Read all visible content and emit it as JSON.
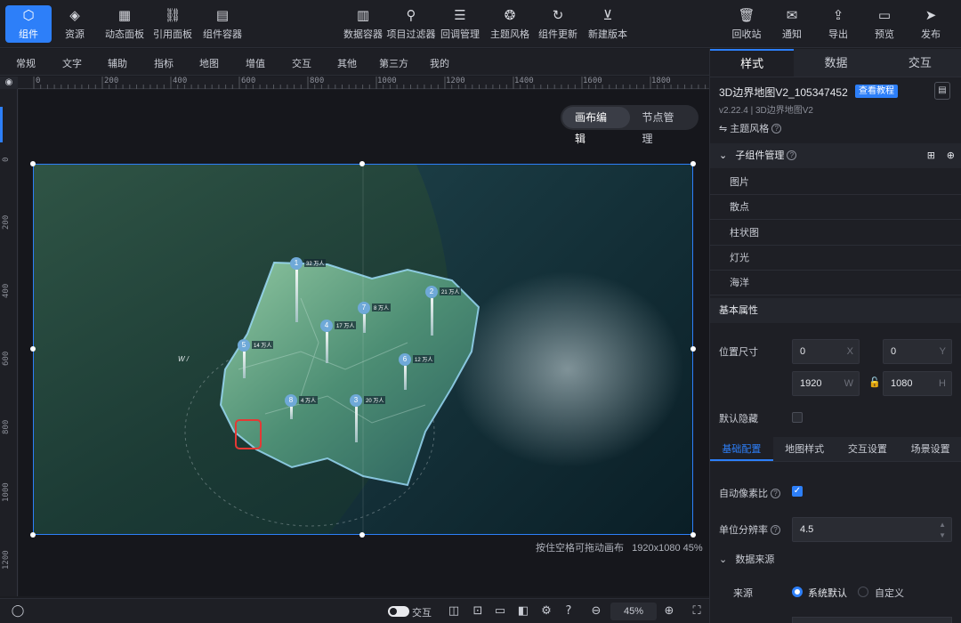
{
  "toolbar": {
    "left": [
      {
        "label": "组件",
        "icon": "component-icon"
      },
      {
        "label": "资源",
        "icon": "layers-icon"
      },
      {
        "label": "动态面板",
        "icon": "panel-icon"
      },
      {
        "label": "引用面板",
        "icon": "link-icon"
      },
      {
        "label": "组件容器",
        "icon": "container-icon"
      }
    ],
    "center": [
      {
        "label": "数据容器",
        "icon": "data-container-icon"
      },
      {
        "label": "项目过滤器",
        "icon": "filter-icon"
      },
      {
        "label": "回调管理",
        "icon": "sliders-icon"
      },
      {
        "label": "主题风格",
        "icon": "palette-icon"
      },
      {
        "label": "组件更新",
        "icon": "refresh-icon"
      },
      {
        "label": "新建版本",
        "icon": "version-icon"
      }
    ],
    "right": [
      {
        "label": "回收站",
        "icon": "trash-icon"
      },
      {
        "label": "通知",
        "icon": "message-icon"
      },
      {
        "label": "导出",
        "icon": "export-icon"
      },
      {
        "label": "预览",
        "icon": "preview-icon"
      },
      {
        "label": "发布",
        "icon": "send-icon"
      }
    ]
  },
  "categories": [
    "常规",
    "文字",
    "辅助",
    "指标",
    "地图",
    "增值",
    "交互",
    "其他",
    "第三方",
    "我的"
  ],
  "ruler": {
    "top": [
      "0",
      "200",
      "400",
      "600",
      "800",
      "1000",
      "1200",
      "1400",
      "1600",
      "1800"
    ],
    "left": [
      "0",
      "200",
      "400",
      "600",
      "800",
      "1000",
      "1200"
    ]
  },
  "canvas": {
    "mode_tabs": [
      "画布编辑",
      "节点管理"
    ],
    "hint": "按住空格可拖动画布",
    "size_info": "1920x1080 45%",
    "compass_label": "W /",
    "markers": [
      {
        "num": "1",
        "value": "32",
        "unit": "万人"
      },
      {
        "num": "2",
        "value": "21",
        "unit": "万人"
      },
      {
        "num": "3",
        "value": "20",
        "unit": "万人"
      },
      {
        "num": "4",
        "value": "17",
        "unit": "万人"
      },
      {
        "num": "5",
        "value": "14",
        "unit": "万人"
      },
      {
        "num": "6",
        "value": "12",
        "unit": "万人"
      },
      {
        "num": "7",
        "value": "8",
        "unit": "万人"
      },
      {
        "num": "8",
        "value": "4",
        "unit": "万人"
      }
    ]
  },
  "bottombar": {
    "interact_label": "交互",
    "zoom": "45%"
  },
  "panel": {
    "tabs": [
      "样式",
      "数据",
      "交互"
    ],
    "component_name": "3D边界地图V2_105347452",
    "tutorial_label": "查看教程",
    "version": "v2.22.4 | 3D边界地图V2",
    "theme_label": "主题风格",
    "subcomponent_header": "子组件管理",
    "subcomponents": [
      "图片",
      "散点",
      "柱状图",
      "灯光",
      "海洋"
    ],
    "basic_props_header": "基本属性",
    "position_label": "位置尺寸",
    "x": "0",
    "x_suffix": "X",
    "y": "0",
    "y_suffix": "Y",
    "w": "1920",
    "w_suffix": "W",
    "h": "1080",
    "h_suffix": "H",
    "hidden_label": "默认隐藏",
    "config_tabs": [
      "基础配置",
      "地图样式",
      "交互设置",
      "场景设置"
    ],
    "auto_pixel_label": "自动像素比",
    "resolution_label": "单位分辨率",
    "resolution_value": "4.5",
    "datasource_header": "数据来源",
    "source_label": "来源",
    "source_options": [
      "系统默认",
      "自定义"
    ]
  }
}
